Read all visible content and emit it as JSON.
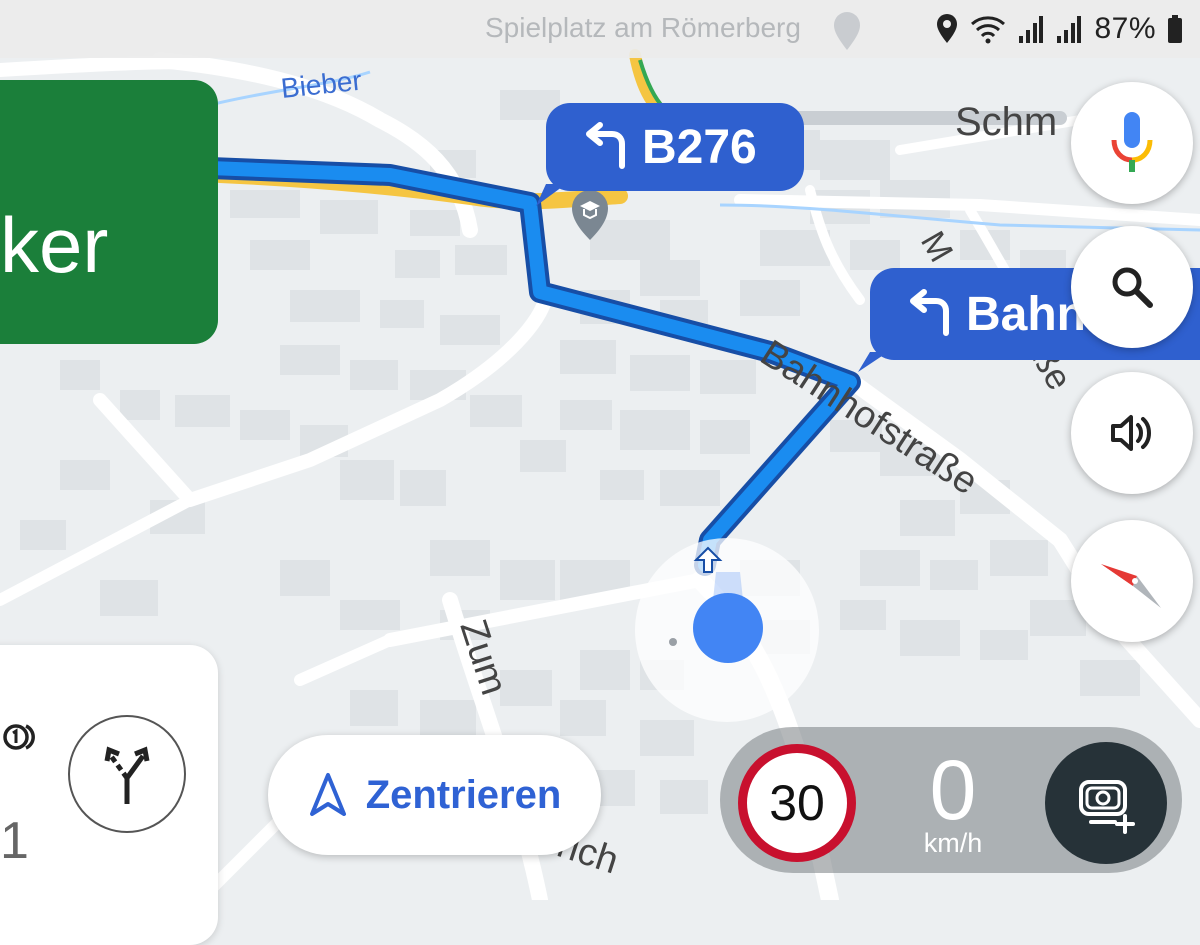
{
  "status_bar": {
    "battery_percent": "87%",
    "icons": [
      "location-icon",
      "wifi-icon",
      "signal-1-icon",
      "signal-2-icon",
      "battery-icon"
    ]
  },
  "map": {
    "place_label": "Spielplatz am Römerberg",
    "labels": {
      "bieber": "Bieber",
      "schm": "Schm",
      "bahnhofstrasse": "Bahnhofstraße",
      "zum": "Zum",
      "rich": "rich",
      "strasse_fragment": "traße",
      "m_fragment": "M"
    }
  },
  "next_turn_card": {
    "street": "ker"
  },
  "route_bubbles": [
    {
      "icon": "turn-left-icon",
      "label": "B276"
    },
    {
      "icon": "turn-left-icon",
      "label": "Bahn"
    }
  ],
  "side_buttons": [
    {
      "name": "voice-search",
      "icon": "microphone-icon"
    },
    {
      "name": "search",
      "icon": "search-icon"
    },
    {
      "name": "sound",
      "icon": "volume-icon"
    },
    {
      "name": "compass",
      "icon": "compass-icon"
    }
  ],
  "recenter_button": {
    "label": "Zentrieren",
    "icon": "navigation-arrow-icon"
  },
  "bottom_card": {
    "icon": "fork-road-icon",
    "partial_value": "1"
  },
  "speed_panel": {
    "speed_limit": "30",
    "speed": "0",
    "unit": "km/h",
    "report_icon": "add-report-icon"
  },
  "colors": {
    "route_blue": "#1a73e8",
    "bubble_blue": "#2f60cf",
    "next_card_green": "#1b7f3a",
    "speed_limit_red": "#c8102e",
    "position_dot": "#4285f4"
  }
}
